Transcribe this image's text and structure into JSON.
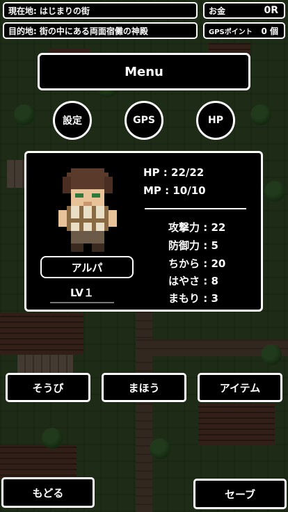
{
  "top": {
    "location_label": "現在地:",
    "location_value": "はじまりの街",
    "money_label": "お金",
    "money_value": "0R",
    "goal_label": "目的地:",
    "goal_value": "街の中にある両面宿儺の神殿",
    "gps_label": "GPSポイント",
    "gps_value": "0 個"
  },
  "menu": {
    "title": "Menu"
  },
  "circle_buttons": {
    "settings": "設定",
    "gps": "GPS",
    "hp": "HP"
  },
  "status": {
    "hp_label": "HP",
    "hp_value": "22/22",
    "mp_label": "MP",
    "mp_value": "10/10",
    "attack_label": "攻撃力",
    "attack_value": "22",
    "defense_label": "防御力",
    "defense_value": "5",
    "power_label": "ちから",
    "power_value": "20",
    "speed_label": "はやさ",
    "speed_value": "8",
    "guard_label": "まもり",
    "guard_value": "3"
  },
  "character": {
    "name": "アルパ",
    "level": "LV１"
  },
  "actions": {
    "equip": "そうび",
    "magic": "まほう",
    "item": "アイテム"
  },
  "footer": {
    "back": "もどる",
    "save": "セーブ"
  },
  "colors": {
    "panel_bg": "#000000",
    "border": "#ffffff",
    "map_dark": "#37502a"
  }
}
